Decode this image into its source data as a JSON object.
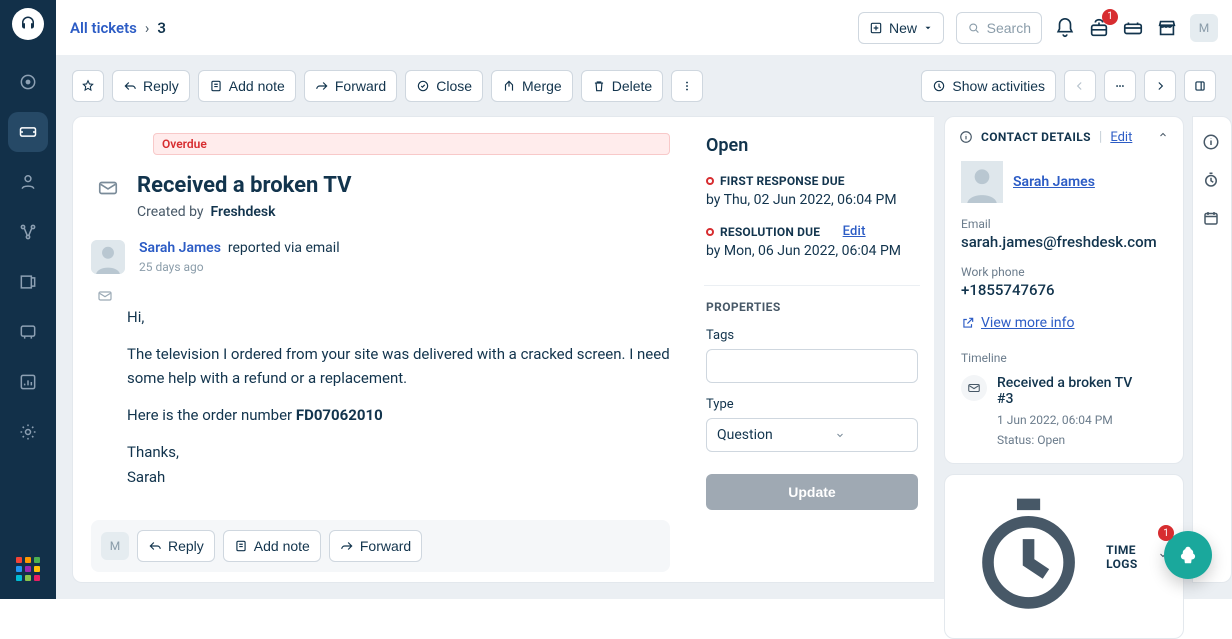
{
  "breadcrumb": {
    "all_tickets": "All tickets",
    "ticket_number": "3"
  },
  "topbar": {
    "new": "New",
    "search": "Search",
    "gift_badge": "1",
    "avatar_initial": "M"
  },
  "actions": {
    "reply": "Reply",
    "add_note": "Add note",
    "forward": "Forward",
    "close": "Close",
    "merge": "Merge",
    "delete": "Delete",
    "show_activities": "Show activities"
  },
  "ticket": {
    "overdue": "Overdue",
    "subject": "Received a broken TV",
    "created_by_label": "Created by",
    "created_by": "Freshdesk",
    "from_name": "Sarah James",
    "via": "reported via email",
    "age": "25 days ago",
    "greeting": "Hi,",
    "paragraph": "The television I ordered from your site was delivered with a cracked screen. I need some help with a refund or a replacement.",
    "order_line_prefix": "Here is the order number ",
    "order_number": "FD07062010",
    "signoff1": "Thanks,",
    "signoff2": "Sarah"
  },
  "footer": {
    "reply": "Reply",
    "add_note": "Add note",
    "forward": "Forward",
    "avatar_initial": "M"
  },
  "status": {
    "title": "Open",
    "first_label": "FIRST RESPONSE DUE",
    "first_value": "by Thu, 02 Jun 2022, 06:04 PM",
    "res_label": "RESOLUTION DUE",
    "res_edit": "Edit",
    "res_value": "by Mon, 06 Jun 2022, 06:04 PM",
    "properties": "PROPERTIES",
    "tags_label": "Tags",
    "type_label": "Type",
    "type_value": "Question",
    "update": "Update"
  },
  "contact": {
    "heading": "CONTACT DETAILS",
    "edit": "Edit",
    "name": "Sarah James",
    "email_label": "Email",
    "email": "sarah.james@freshdesk.com",
    "phone_label": "Work phone",
    "phone": "+1855747676",
    "view_more": "View more info",
    "timeline_label": "Timeline",
    "tl_title": "Received a broken TV",
    "tl_ref": "#3",
    "tl_date": "1 Jun 2022, 06:04 PM",
    "tl_status": "Status: Open"
  },
  "timelogs": {
    "heading": "TIME LOGS"
  },
  "fab": {
    "badge": "1"
  }
}
